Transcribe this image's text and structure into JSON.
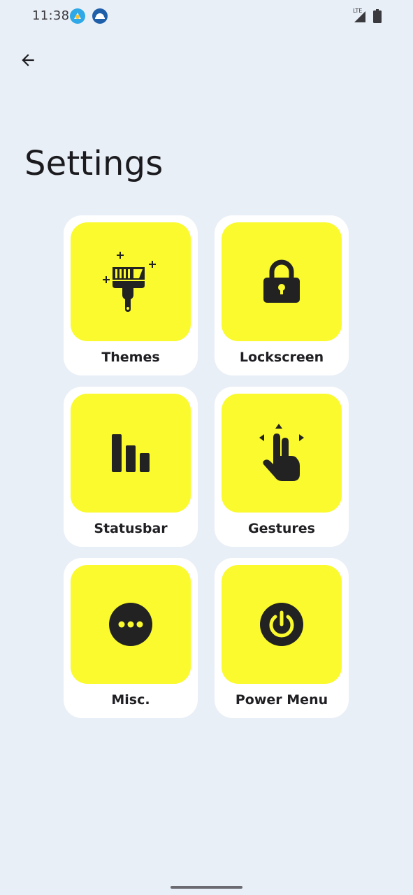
{
  "status_bar": {
    "time": "11:38",
    "icons": [
      "app-notification-icon",
      "app-notification-icon",
      "signal-lte-icon",
      "battery-icon"
    ]
  },
  "header": {
    "back_icon": "back-arrow-icon",
    "title": "Settings"
  },
  "tiles": [
    {
      "label": "Themes",
      "icon": "paintbrush-icon"
    },
    {
      "label": "Lockscreen",
      "icon": "lock-icon"
    },
    {
      "label": "Statusbar",
      "icon": "bar-chart-icon"
    },
    {
      "label": "Gestures",
      "icon": "hand-gesture-icon"
    },
    {
      "label": "Misc.",
      "icon": "more-icon"
    },
    {
      "label": "Power Menu",
      "icon": "power-icon"
    }
  ],
  "colors": {
    "background": "#e9eff7",
    "tile": "#ffffff",
    "accent": "#fafa2e",
    "icon": "#222222"
  }
}
